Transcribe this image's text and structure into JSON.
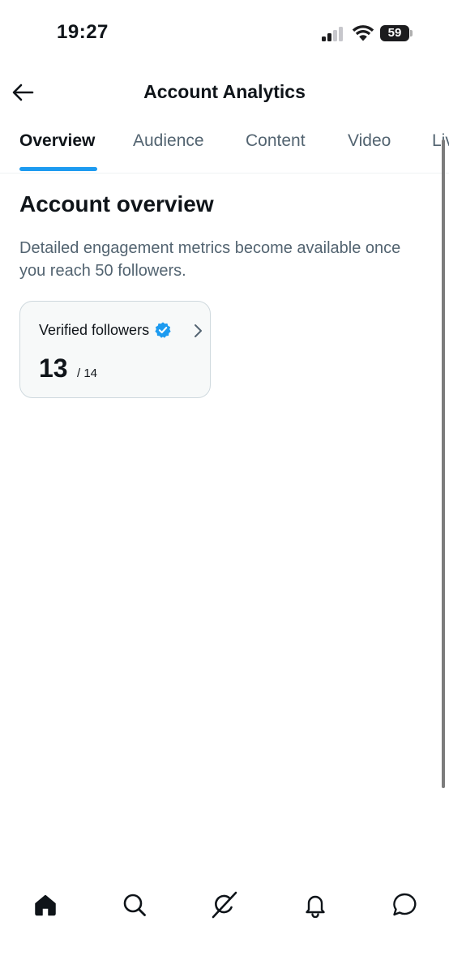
{
  "status_bar": {
    "time": "19:27",
    "battery_level": "59",
    "signal_bars_active": 2,
    "signal_bars_total": 4
  },
  "header": {
    "title": "Account Analytics",
    "back_icon": "arrow-left-icon"
  },
  "tabs": [
    {
      "label": "Overview",
      "active": true
    },
    {
      "label": "Audience",
      "active": false
    },
    {
      "label": "Content",
      "active": false
    },
    {
      "label": "Video",
      "active": false
    },
    {
      "label": "Live",
      "active": false
    }
  ],
  "overview": {
    "title": "Account overview",
    "description": "Detailed engagement metrics become available once you reach 50 followers.",
    "metric_card": {
      "label": "Verified followers",
      "value": "13",
      "total": "/ 14",
      "badge_icon": "verified-badge-icon",
      "chevron_icon": "chevron-right-icon"
    }
  },
  "bottom_nav": {
    "items": [
      {
        "name": "home",
        "icon": "home-icon",
        "active": true
      },
      {
        "name": "search",
        "icon": "search-icon",
        "active": false
      },
      {
        "name": "grok",
        "icon": "grok-icon",
        "active": false
      },
      {
        "name": "notifications",
        "icon": "bell-icon",
        "active": false
      },
      {
        "name": "messages",
        "icon": "message-icon",
        "active": false
      }
    ]
  },
  "colors": {
    "accent": "#1d9bf0",
    "text_primary": "#0f1419",
    "text_secondary": "#536471",
    "card_bg": "#f7f9f9",
    "card_border": "#cfd9de"
  }
}
